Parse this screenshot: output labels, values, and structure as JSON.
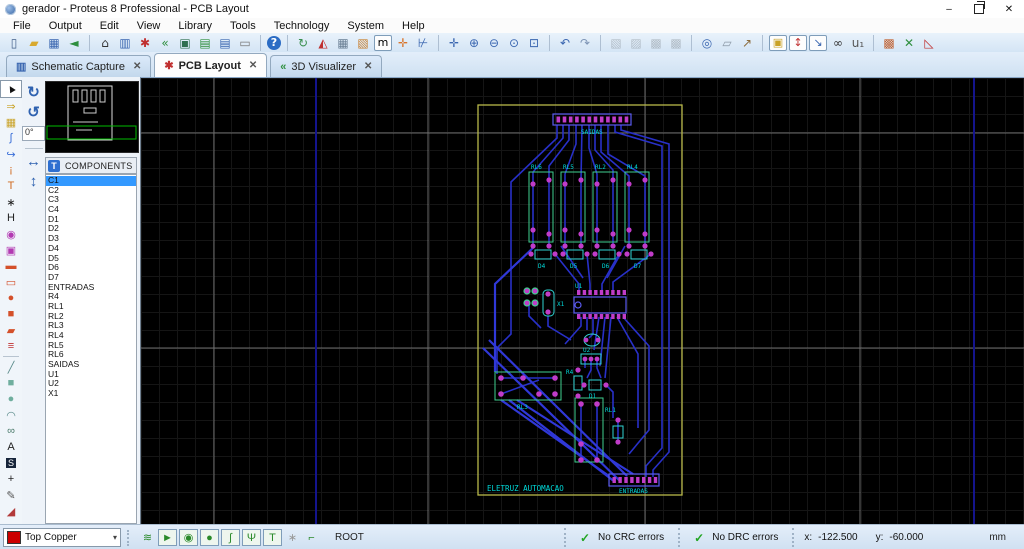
{
  "window": {
    "title": "gerador - Proteus 8 Professional - PCB Layout",
    "controls": {
      "minimize": "–",
      "close": "✕"
    }
  },
  "menu": {
    "items": [
      "File",
      "Output",
      "Edit",
      "View",
      "Library",
      "Tools",
      "Technology",
      "System",
      "Help"
    ]
  },
  "toolbar": {
    "groups": [
      [
        {
          "name": "new-file",
          "glyph": "▯",
          "color": "#44608a"
        },
        {
          "name": "open-folder",
          "glyph": "▰",
          "color": "#d8a92e"
        },
        {
          "name": "save",
          "glyph": "▦",
          "color": "#3a66b0"
        },
        {
          "name": "import-design",
          "glyph": "◄",
          "color": "#2f8f3f"
        }
      ],
      [
        {
          "name": "home",
          "glyph": "⌂",
          "color": "#333333"
        },
        {
          "name": "schematic-capture",
          "glyph": "▥",
          "color": "#3a66b0"
        },
        {
          "name": "pcb-layout",
          "glyph": "✱",
          "color": "#c03030"
        },
        {
          "name": "3d-visualizer",
          "glyph": "«",
          "color": "#2f8f3f"
        },
        {
          "name": "gerber-viewer",
          "glyph": "▣",
          "color": "#2f6f4f"
        },
        {
          "name": "design-explorer",
          "glyph": "▤",
          "color": "#2f8f3f"
        },
        {
          "name": "bill-of-materials",
          "glyph": "▤",
          "color": "#3a66b0"
        },
        {
          "name": "electrical-report",
          "glyph": "▭",
          "color": "#777777"
        }
      ],
      [
        {
          "name": "help",
          "glyph": "?",
          "color": "#ffffff",
          "round": true
        }
      ],
      [
        {
          "name": "redraw",
          "glyph": "↻",
          "color": "#3a8f4f"
        },
        {
          "name": "flip-mirror",
          "glyph": "◭",
          "color": "#c03030"
        },
        {
          "name": "grid-toggle",
          "glyph": "▦",
          "color": "#6a7f94"
        },
        {
          "name": "layer-cube",
          "glyph": "▧",
          "color": "#c87f2f"
        },
        {
          "name": "metric-toggle",
          "glyph": "m",
          "color": "#000000",
          "boxed": true
        },
        {
          "name": "false-origin",
          "glyph": "✛",
          "color": "#d8742a"
        },
        {
          "name": "x-cursor",
          "glyph": "⊬",
          "color": "#3a66b0"
        }
      ],
      [
        {
          "name": "pan",
          "glyph": "✛",
          "color": "#3a66b0"
        },
        {
          "name": "zoom-in",
          "glyph": "⊕",
          "color": "#3a66b0"
        },
        {
          "name": "zoom-out",
          "glyph": "⊖",
          "color": "#3a66b0"
        },
        {
          "name": "zoom-all",
          "glyph": "⊙",
          "color": "#3a66b0"
        },
        {
          "name": "zoom-area",
          "glyph": "⊡",
          "color": "#3a66b0"
        }
      ],
      [
        {
          "name": "undo",
          "glyph": "↶",
          "color": "#3a66b0"
        },
        {
          "name": "redo",
          "glyph": "↷",
          "color": "#7d94b5"
        }
      ],
      [
        {
          "name": "block-copy",
          "glyph": "▧",
          "color": "#667788",
          "disabled": true
        },
        {
          "name": "block-move",
          "glyph": "▨",
          "color": "#667788",
          "disabled": true
        },
        {
          "name": "block-rotate",
          "glyph": "▩",
          "color": "#667788",
          "disabled": true
        },
        {
          "name": "block-delete",
          "glyph": "▩",
          "color": "#667788",
          "disabled": true
        }
      ],
      [
        {
          "name": "goto-component",
          "glyph": "◎",
          "color": "#3a66b0"
        },
        {
          "name": "new-package",
          "glyph": "▱",
          "color": "#8a97a5"
        },
        {
          "name": "wrench-tool",
          "glyph": "↗",
          "color": "#8a6a3a"
        }
      ],
      [
        {
          "name": "trace-style-lock",
          "glyph": "▣",
          "color": "#c9a227",
          "boxed": true
        },
        {
          "name": "auto-track-necking",
          "glyph": "↕",
          "color": "#c03030",
          "boxed": true
        },
        {
          "name": "trace-angle-snap",
          "glyph": "↘",
          "color": "#3a66b0",
          "boxed": true
        },
        {
          "name": "search-components",
          "glyph": "∞",
          "color": "#333333"
        },
        {
          "name": "re-annotate",
          "glyph": "u₁",
          "color": "#555555"
        }
      ],
      [
        {
          "name": "design-rule-manager",
          "glyph": "▩",
          "color": "#c06030"
        },
        {
          "name": "auto-placer",
          "glyph": "✕",
          "color": "#2f8f3f"
        },
        {
          "name": "measurement",
          "glyph": "◺",
          "color": "#c03030"
        }
      ]
    ]
  },
  "tabs": [
    {
      "label": "Schematic Capture",
      "icon_glyph": "▥",
      "icon_color": "#3a66b0",
      "close_glyph": "✕",
      "active": false
    },
    {
      "label": "PCB Layout",
      "icon_glyph": "✱",
      "icon_color": "#c03030",
      "close_glyph": "✕",
      "active": true
    },
    {
      "label": "3D Visualizer",
      "icon_glyph": "«",
      "icon_color": "#2f8f3f",
      "close_glyph": "✕",
      "active": false
    }
  ],
  "rotate": {
    "angle": "0°",
    "buttons": [
      {
        "name": "rotate-clockwise",
        "glyph": "↻"
      },
      {
        "name": "rotate-anticlockwise",
        "glyph": "↺"
      }
    ],
    "flips": [
      {
        "name": "flip-horizontal",
        "glyph": "↔"
      },
      {
        "name": "flip-vertical",
        "glyph": "↕"
      }
    ]
  },
  "components_panel": {
    "header": "COMPONENTS",
    "selected_index": 0,
    "items": [
      "C1",
      "C2",
      "C3",
      "C4",
      "D1",
      "D2",
      "D3",
      "D4",
      "D5",
      "D6",
      "D7",
      "ENTRADAS",
      "R4",
      "RL1",
      "RL2",
      "RL3",
      "RL4",
      "RL5",
      "RL6",
      "SAIDAS",
      "U1",
      "U2",
      "X1"
    ]
  },
  "left_toolbar": [
    {
      "name": "selection-mode",
      "glyph": "▲",
      "color": "#111111",
      "rot": -30,
      "pressed": true
    },
    {
      "name": "component-mode",
      "glyph": "⇒",
      "color": "#c9a227"
    },
    {
      "name": "package-mode",
      "glyph": "▦",
      "color": "#c9a227"
    },
    {
      "name": "trace-mode",
      "glyph": "∫",
      "color": "#3a6fd8"
    },
    {
      "name": "arc-trace-mode",
      "glyph": "↪",
      "color": "#3a6fd8"
    },
    {
      "name": "via-mode",
      "glyph": "¡",
      "color": "#d06a1f"
    },
    {
      "name": "text-mode",
      "glyph": "T",
      "color": "#d06a1f"
    },
    {
      "name": "pad-star-mode",
      "glyph": "∗",
      "color": "#222222"
    },
    {
      "name": "connectivity-mode",
      "glyph": "H",
      "color": "#222222"
    },
    {
      "name": "round-pad-mode",
      "glyph": "◉",
      "color": "#b23ab2"
    },
    {
      "name": "square-pad-mode",
      "glyph": "▣",
      "color": "#b23ab2"
    },
    {
      "name": "dil-pad-mode",
      "glyph": "▬",
      "color": "#d4502a"
    },
    {
      "name": "edge-pad-mode",
      "glyph": "▭",
      "color": "#d4502a"
    },
    {
      "name": "circle-pad-mode",
      "glyph": "●",
      "color": "#d4502a"
    },
    {
      "name": "rect-pad-mode",
      "glyph": "■",
      "color": "#d4502a"
    },
    {
      "name": "poly-pad-mode",
      "glyph": "▰",
      "color": "#d4502a"
    },
    {
      "name": "padstack-mode",
      "glyph": "≡",
      "color": "#c03030"
    },
    {
      "name": "divider",
      "divider": true
    },
    {
      "name": "line-2d-mode",
      "glyph": "╱",
      "color": "#5a8a8a"
    },
    {
      "name": "box-2d-mode",
      "glyph": "■",
      "color": "#6fae9e"
    },
    {
      "name": "circle-2d-mode",
      "glyph": "●",
      "color": "#6fae9e"
    },
    {
      "name": "arc-2d-mode",
      "glyph": "◠",
      "color": "#5a8a8a"
    },
    {
      "name": "path-2d-mode",
      "glyph": "∞",
      "color": "#4a7a6a"
    },
    {
      "name": "text-2d-mode",
      "glyph": "A",
      "color": "#222222"
    },
    {
      "name": "symbol-2d-mode",
      "glyph": "S",
      "color": "#16243a"
    },
    {
      "name": "marker-mode",
      "glyph": "+",
      "color": "#222222"
    },
    {
      "name": "dimension-mode",
      "glyph": "✎",
      "color": "#555555"
    },
    {
      "name": "ruler-mode",
      "glyph": "◢",
      "color": "#b23a3a"
    }
  ],
  "statusbar": {
    "layer_selector": {
      "label": "Top Copper",
      "swatch_color": "#cc0000",
      "caret": "▾"
    },
    "icons": [
      {
        "name": "layer-stack",
        "glyph": "≋",
        "color": "#2a8a2a"
      },
      {
        "name": "drag-mode",
        "glyph": "►",
        "color": "#2a8a2a",
        "boxed": true
      },
      {
        "name": "pad-tool",
        "glyph": "◉",
        "color": "#2a8a2a",
        "boxed": true
      },
      {
        "name": "via-tool",
        "glyph": "●",
        "color": "#2a8a2a",
        "boxed": true
      },
      {
        "name": "route-tool",
        "glyph": "∫",
        "color": "#2a8a2a",
        "boxed": true
      },
      {
        "name": "tidy-tool",
        "glyph": "Ψ",
        "color": "#2a8a2a",
        "boxed": true
      },
      {
        "name": "text-tool",
        "glyph": "T",
        "color": "#2a8a2a",
        "boxed": true
      },
      {
        "name": "star-tool",
        "glyph": "∗",
        "color": "#999999"
      },
      {
        "name": "net-tool",
        "glyph": "⌐",
        "color": "#2a8a2a"
      }
    ],
    "root_label": "ROOT",
    "crc_status": "No CRC errors",
    "drc_status": "No DRC errors",
    "check_glyph": "✓",
    "coords": {
      "x_label": "x:",
      "x_value": "-122.500",
      "y_label": "y:",
      "y_value": "-60.000"
    },
    "units": "mm"
  },
  "pcb": {
    "board_text": "ELETRUZ AUTOMACAO",
    "top_connector_label": "SAIDAS",
    "bottom_connector_label": "ENTRADAS",
    "relay_labels": [
      "RL6",
      "RL5",
      "RL2",
      "RL4"
    ],
    "diode_labels": [
      "D4",
      "D5",
      "D6",
      "D7"
    ],
    "ic_label": "U1",
    "crystal_label": "X1",
    "u2_label": "U2",
    "d1_label": "D1",
    "r4_label": "R4",
    "rl3_label": "RL3",
    "rl1_label": "RL1",
    "colors": {
      "board_outline": "#b9b94a",
      "trace": "#2830c8",
      "pad": "#c03cc8",
      "silk_green": "#3fcf8f",
      "silk_cyan": "#2fd4d4",
      "connector_blue": "#5a5af0",
      "label_cyan": "#00d9d9"
    }
  }
}
